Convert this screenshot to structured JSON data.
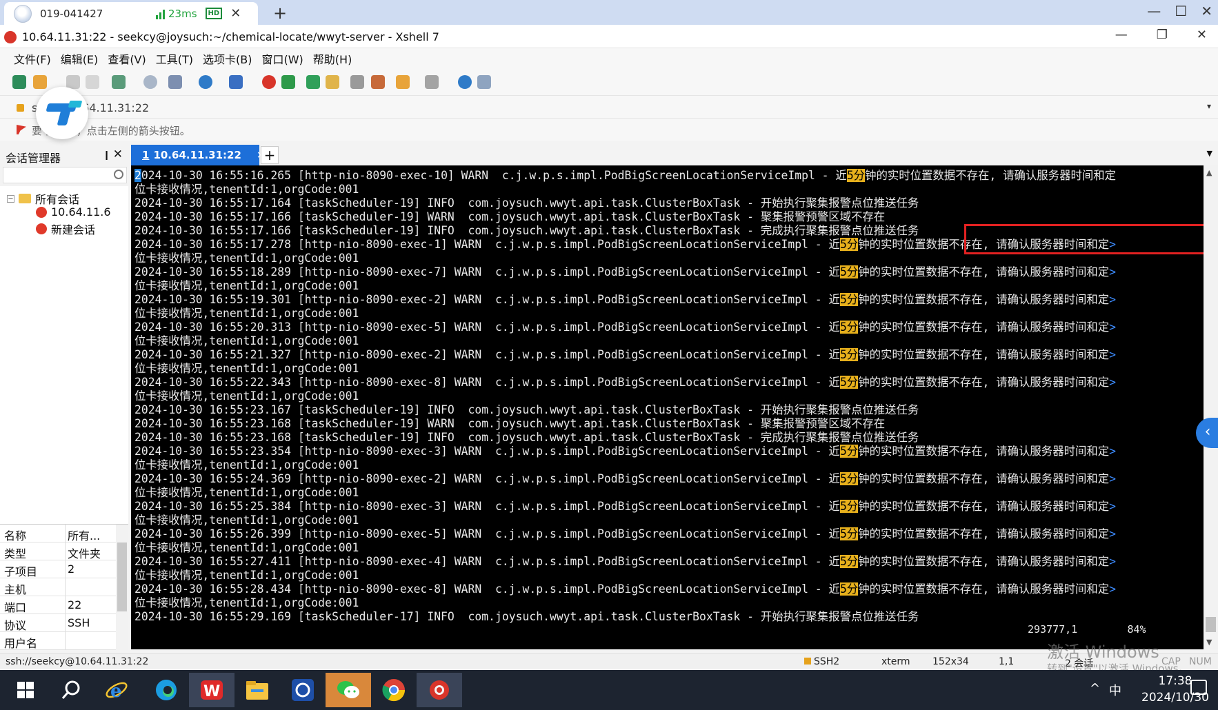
{
  "remote": {
    "tab_name": "019-041427",
    "latency": "23ms",
    "hd": "HD",
    "close": "✕",
    "new_tab": "+",
    "ctrls": [
      "—",
      "☐",
      "✕"
    ]
  },
  "window": {
    "title": "10.64.11.31:22 - seekcy@joysuch:~/chemical-locate/wwyt-server - Xshell 7",
    "ctrls": [
      "—",
      "❐",
      "✕"
    ]
  },
  "menu": [
    "文件(F)",
    "编辑(E)",
    "查看(V)",
    "工具(T)",
    "选项卡(B)",
    "窗口(W)",
    "帮助(H)"
  ],
  "address": {
    "text": "s           cy@10.64.11.31:22",
    "dropdown": "▾"
  },
  "hint": "要          前会话，点击左侧的箭头按钮。",
  "session_manager": {
    "title": "会话管理器",
    "pin": "❙",
    "close": "✕",
    "tree": {
      "root": "所有会话",
      "children": [
        "10.64.11.6",
        "新建会话"
      ]
    },
    "properties": [
      {
        "key": "名称",
        "value": "所有..."
      },
      {
        "key": "类型",
        "value": "文件夹"
      },
      {
        "key": "子项目",
        "value": "2"
      },
      {
        "key": "主机",
        "value": ""
      },
      {
        "key": "端口",
        "value": "22"
      },
      {
        "key": "协议",
        "value": "SSH"
      },
      {
        "key": "用户名",
        "value": ""
      }
    ]
  },
  "terminal_tab": {
    "num": "1",
    "label": "10.64.11.31:22",
    "close": "×",
    "add": "+"
  },
  "terminal": {
    "cursor_char": "2",
    "first_line_rest": "024-10-30 16:55:16.265 [http-nio-8090-exec-10] WARN  c.j.w.p.s.impl.PodBigScreenLocationServiceImpl - 近",
    "hl_text": "5分",
    "warn_tail": "钟的实时位置数据不存在, 请确认服务器时间和定",
    "more": ">",
    "wrap": "位卡接收情况,tenentId:1,orgCode:001",
    "cluster_lines": [
      "2024-10-30 16:55:17.164 [taskScheduler-19] INFO  com.joysuch.wwyt.api.task.ClusterBoxTask - 开始执行聚集报警点位推送任务",
      "2024-10-30 16:55:17.166 [taskScheduler-19] WARN  com.joysuch.wwyt.api.task.ClusterBoxTask - 聚集报警预警区域不存在",
      "2024-10-30 16:55:17.166 [taskScheduler-19] INFO  com.joysuch.wwyt.api.task.ClusterBoxTask - 完成执行聚集报警点位推送任务",
      "2024-10-30 16:55:23.167 [taskScheduler-19] INFO  com.joysuch.wwyt.api.task.ClusterBoxTask - 开始执行聚集报警点位推送任务",
      "2024-10-30 16:55:23.168 [taskScheduler-19] WARN  com.joysuch.wwyt.api.task.ClusterBoxTask - 聚集报警预警区域不存在",
      "2024-10-30 16:55:23.168 [taskScheduler-19] INFO  com.joysuch.wwyt.api.task.ClusterBoxTask - 完成执行聚集报警点位推送任务",
      "2024-10-30 16:55:29.169 [taskScheduler-17] INFO  com.joysuch.wwyt.api.task.ClusterBoxTask - 开始执行聚集报警点位推送任务"
    ],
    "warn_prefixes": [
      "2024-10-30 16:55:17.278 [http-nio-8090-exec-1] WARN  c.j.w.p.s.impl.PodBigScreenLocationServiceImpl - 近",
      "2024-10-30 16:55:18.289 [http-nio-8090-exec-7] WARN  c.j.w.p.s.impl.PodBigScreenLocationServiceImpl - 近",
      "2024-10-30 16:55:19.301 [http-nio-8090-exec-2] WARN  c.j.w.p.s.impl.PodBigScreenLocationServiceImpl - 近",
      "2024-10-30 16:55:20.313 [http-nio-8090-exec-5] WARN  c.j.w.p.s.impl.PodBigScreenLocationServiceImpl - 近",
      "2024-10-30 16:55:21.327 [http-nio-8090-exec-2] WARN  c.j.w.p.s.impl.PodBigScreenLocationServiceImpl - 近",
      "2024-10-30 16:55:22.343 [http-nio-8090-exec-8] WARN  c.j.w.p.s.impl.PodBigScreenLocationServiceImpl - 近",
      "2024-10-30 16:55:23.354 [http-nio-8090-exec-3] WARN  c.j.w.p.s.impl.PodBigScreenLocationServiceImpl - 近",
      "2024-10-30 16:55:24.369 [http-nio-8090-exec-2] WARN  c.j.w.p.s.impl.PodBigScreenLocationServiceImpl - 近",
      "2024-10-30 16:55:25.384 [http-nio-8090-exec-3] WARN  c.j.w.p.s.impl.PodBigScreenLocationServiceImpl - 近",
      "2024-10-30 16:55:26.399 [http-nio-8090-exec-5] WARN  c.j.w.p.s.impl.PodBigScreenLocationServiceImpl - 近",
      "2024-10-30 16:55:27.411 [http-nio-8090-exec-4] WARN  c.j.w.p.s.impl.PodBigScreenLocationServiceImpl - 近",
      "2024-10-30 16:55:28.434 [http-nio-8090-exec-8] WARN  c.j.w.p.s.impl.PodBigScreenLocationServiceImpl - 近"
    ],
    "status_position": "293777,1",
    "status_percent": "84%"
  },
  "statusbar": {
    "connection": "ssh://seekcy@10.64.11.31:22",
    "protocol": "SSH2",
    "term": "xterm",
    "size": "152x34",
    "cursor": "1,1",
    "sessions": "2 会话",
    "cap": "CAP",
    "num": "NUM"
  },
  "watermark": {
    "line1": "激活 Windows",
    "line2": "转到\"设置\"以激活 Windows。"
  },
  "taskbar": {
    "ime": "中",
    "caret": "^",
    "time": "17:38",
    "date": "2024/10/30"
  },
  "colors": {
    "accent": "#1d6fd9",
    "highlight": "#e7b01c",
    "annotation_box": "#e32121"
  }
}
